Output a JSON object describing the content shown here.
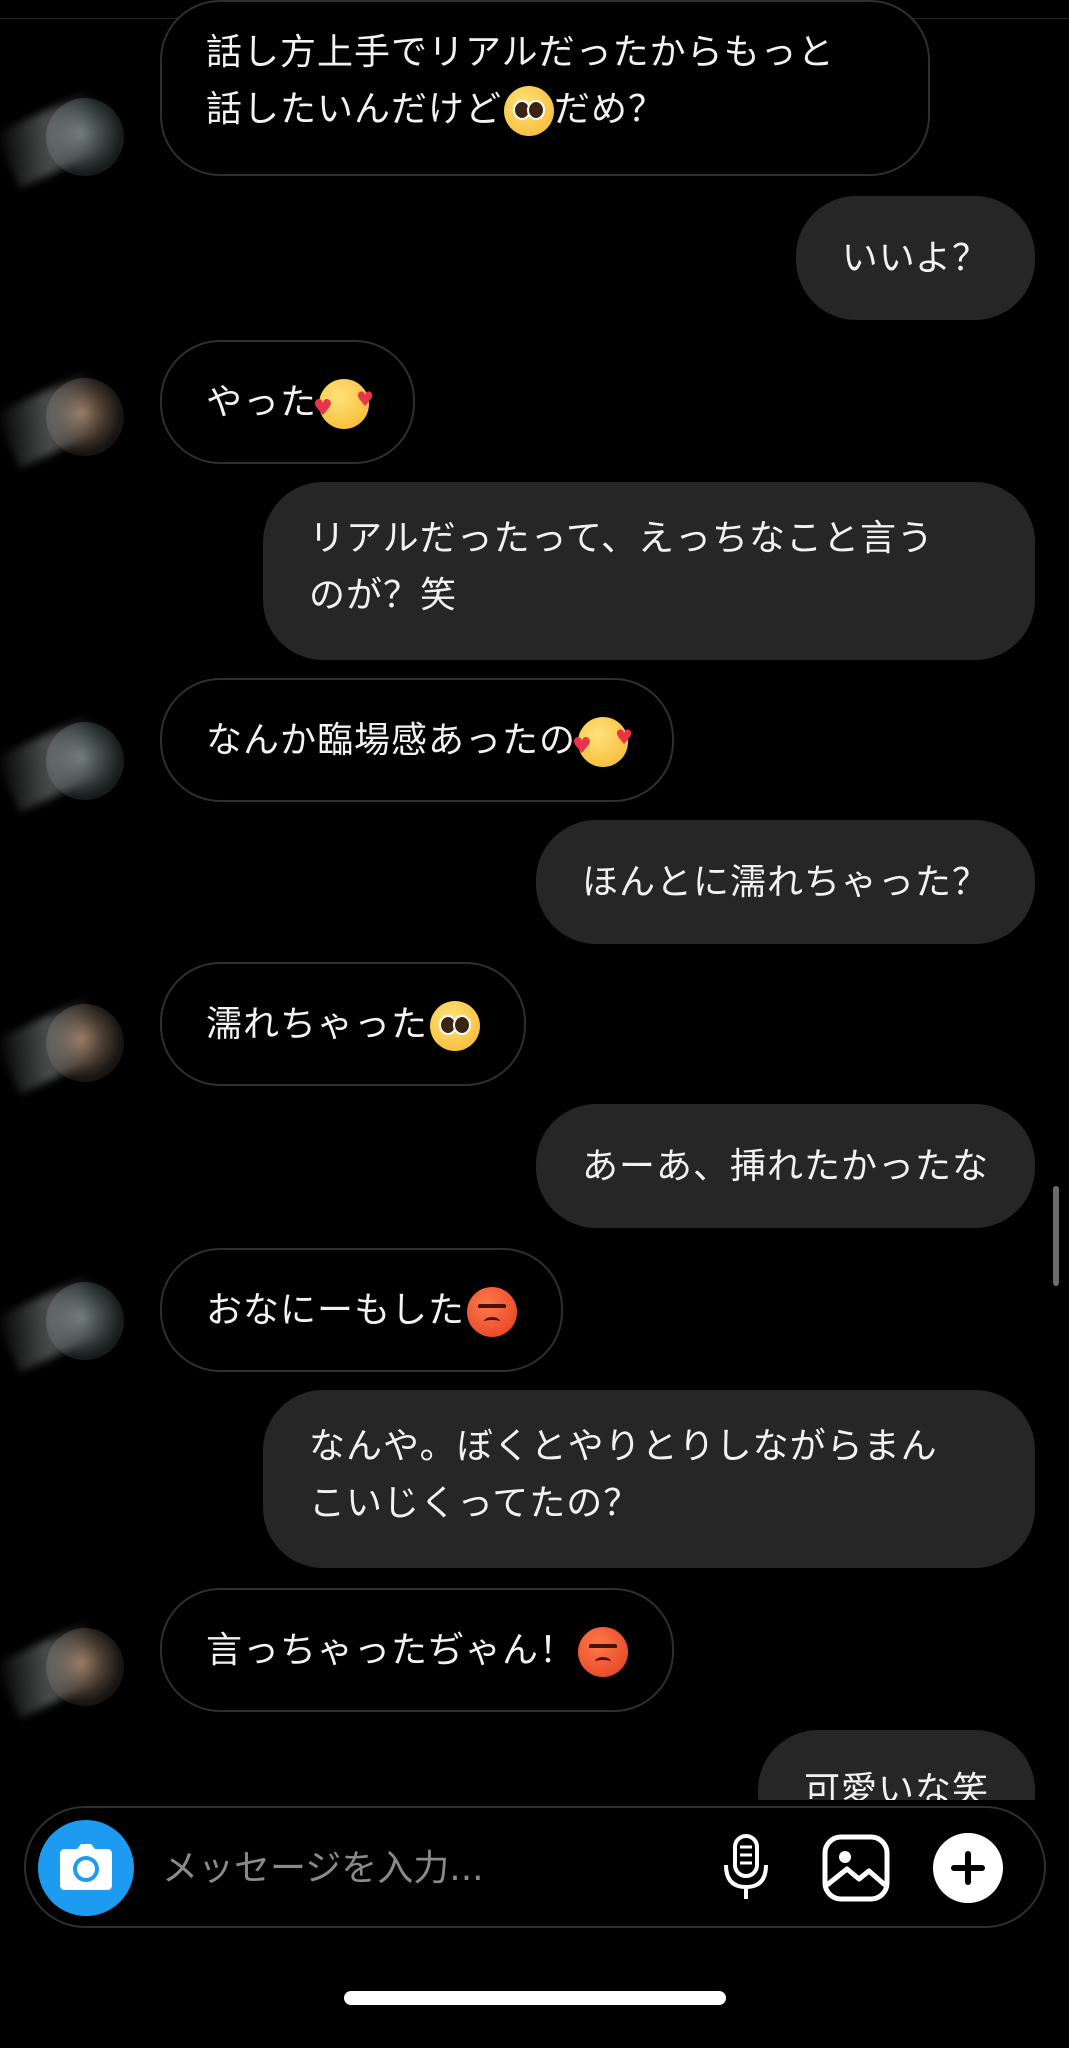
{
  "messages": [
    {
      "dir": "in",
      "text": "話し方上手でリアルだったからもっと\n話したいんだけど",
      "emoji": "pleading-face",
      "suffix": "だめ？"
    },
    {
      "dir": "out",
      "text": "いいよ？"
    },
    {
      "dir": "in",
      "text": "やった",
      "emoji": "smiling-face-with-hearts",
      "suffix": ""
    },
    {
      "dir": "out",
      "text": "リアルだったって、えっちなこと言う\nのが？笑"
    },
    {
      "dir": "in",
      "text": "なんか臨場感あったの",
      "emoji": "smiling-face-with-hearts",
      "suffix": ""
    },
    {
      "dir": "out",
      "text": "ほんとに濡れちゃった？"
    },
    {
      "dir": "in",
      "text": "濡れちゃった",
      "emoji": "pleading-face",
      "suffix": ""
    },
    {
      "dir": "out",
      "text": "あーあ、挿れたかったな"
    },
    {
      "dir": "in",
      "text": "おなにーもした",
      "emoji": "angry-face",
      "suffix": ""
    },
    {
      "dir": "out",
      "text": "なんや。ぼくとやりとりしながらまん\nこいじくってたの？"
    },
    {
      "dir": "in",
      "text": "言っちゃったぢゃん！",
      "emoji": "angry-face",
      "suffix": ""
    },
    {
      "dir": "out",
      "text": "可愛いな笑"
    }
  ],
  "composer": {
    "placeholder": "メッセージを入力...",
    "icons": [
      "camera-icon",
      "microphone-icon",
      "gallery-icon",
      "plus-icon"
    ]
  },
  "colors": {
    "background": "#000000",
    "outgoing_bubble": "#262626",
    "incoming_border": "#2f2f2f",
    "camera_button": "#1d9bf0",
    "text": "#f2f2f2",
    "placeholder": "#8a8a8a"
  }
}
